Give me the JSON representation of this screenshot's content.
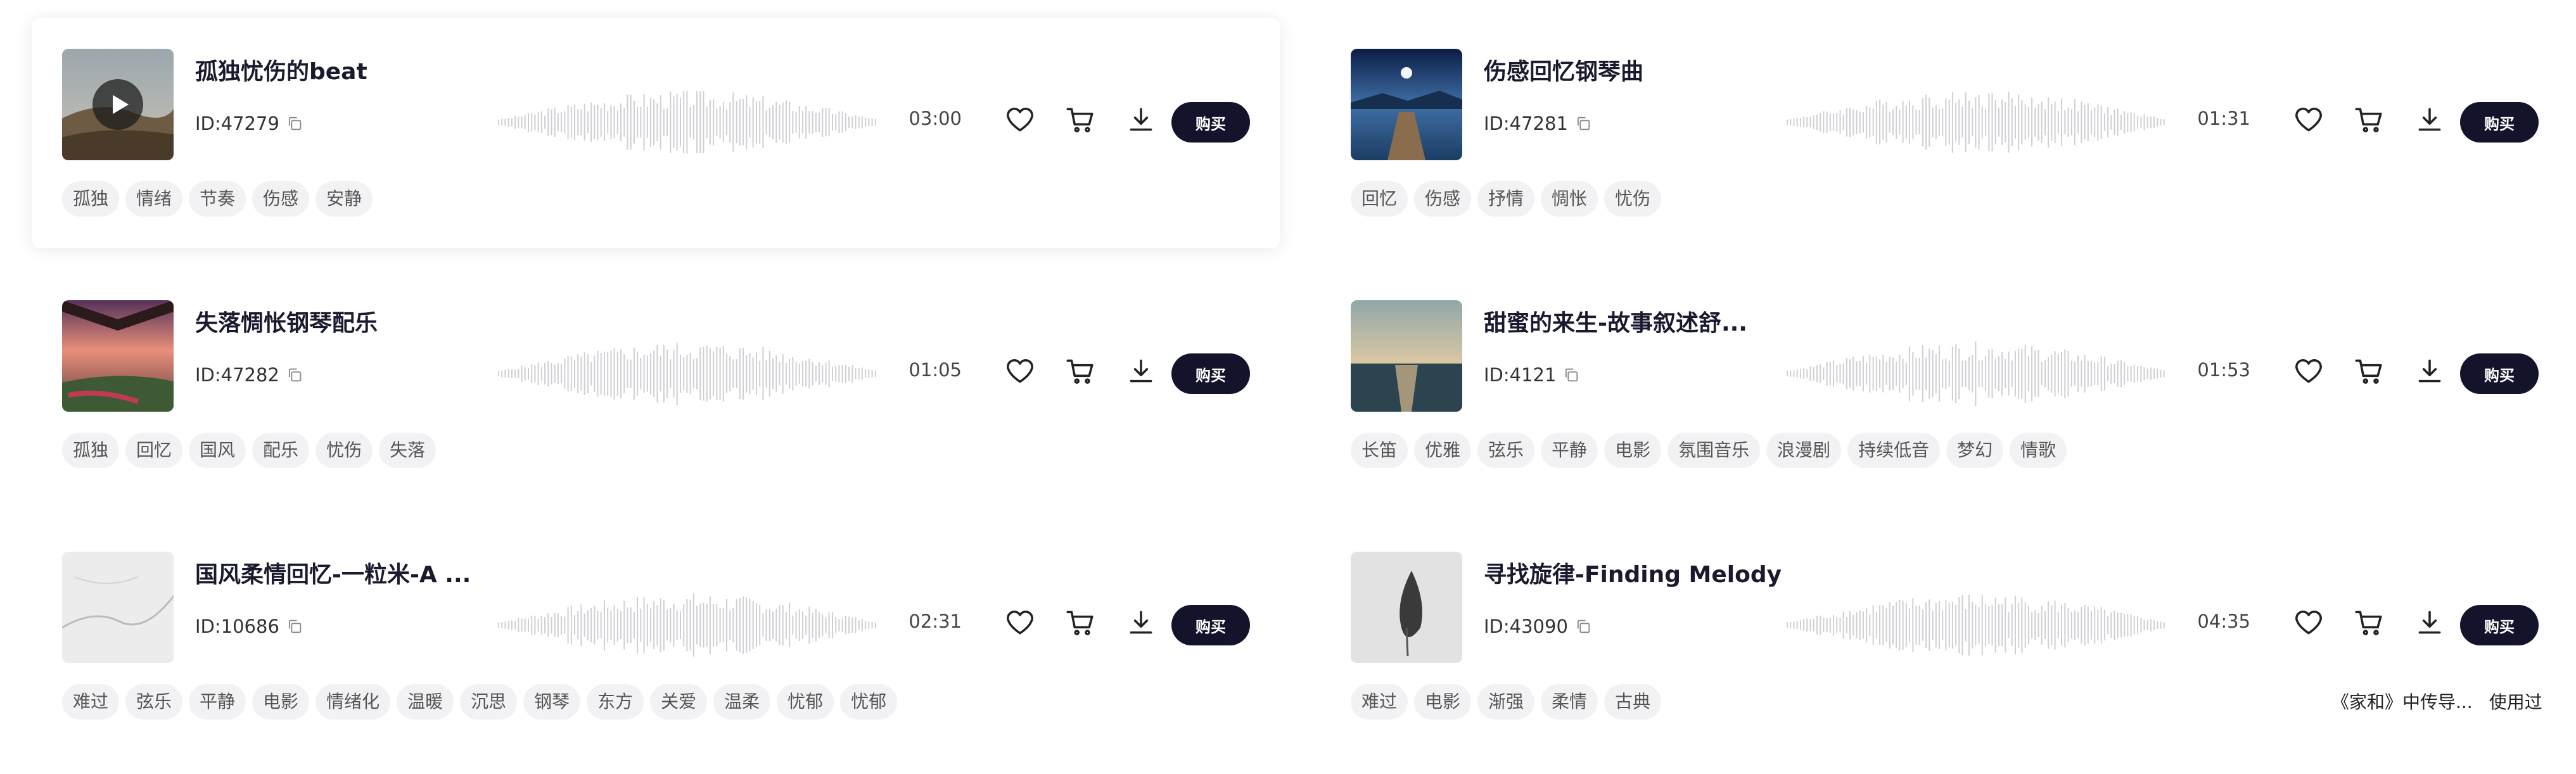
{
  "buy_label": "购买",
  "tracks": [
    {
      "title": "孤独忧伤的beat",
      "id": "ID:47279",
      "duration": "03:00",
      "cover": "hills",
      "active": true,
      "tags": [
        "孤独",
        "情绪",
        "节奏",
        "伤感",
        "安静"
      ]
    },
    {
      "title": "伤感回忆钢琴曲",
      "id": "ID:47281",
      "duration": "01:31",
      "cover": "pier",
      "active": false,
      "tags": [
        "回忆",
        "伤感",
        "抒情",
        "惆怅",
        "忧伤"
      ]
    },
    {
      "title": "失落惆怅钢琴配乐",
      "id": "ID:47282",
      "duration": "01:05",
      "cover": "sunset",
      "active": false,
      "tags": [
        "孤独",
        "回忆",
        "国风",
        "配乐",
        "忧伤",
        "失落"
      ]
    },
    {
      "title": "甜蜜的来生-故事叙述舒...",
      "id": "ID:4121",
      "duration": "01:53",
      "cover": "sea",
      "active": false,
      "tags": [
        "长笛",
        "优雅",
        "弦乐",
        "平静",
        "电影",
        "氛围音乐",
        "浪漫剧",
        "持续低音",
        "梦幻",
        "情歌"
      ]
    },
    {
      "title": "国风柔情回忆-一粒米-A ...",
      "id": "ID:10686",
      "duration": "02:31",
      "cover": "paper",
      "active": false,
      "tags": [
        "难过",
        "弦乐",
        "平静",
        "电影",
        "情绪化",
        "温暖",
        "沉思",
        "钢琴",
        "东方",
        "关爱",
        "温柔",
        "忧郁",
        "忧郁"
      ]
    },
    {
      "title": "寻找旋律-Finding Melody",
      "id": "ID:43090",
      "duration": "04:35",
      "cover": "ink",
      "active": false,
      "tags": [
        "难过",
        "电影",
        "渐强",
        "柔情",
        "古典"
      ]
    }
  ],
  "usage_note": {
    "text": "《家和》中传导...",
    "label": "使用过"
  }
}
